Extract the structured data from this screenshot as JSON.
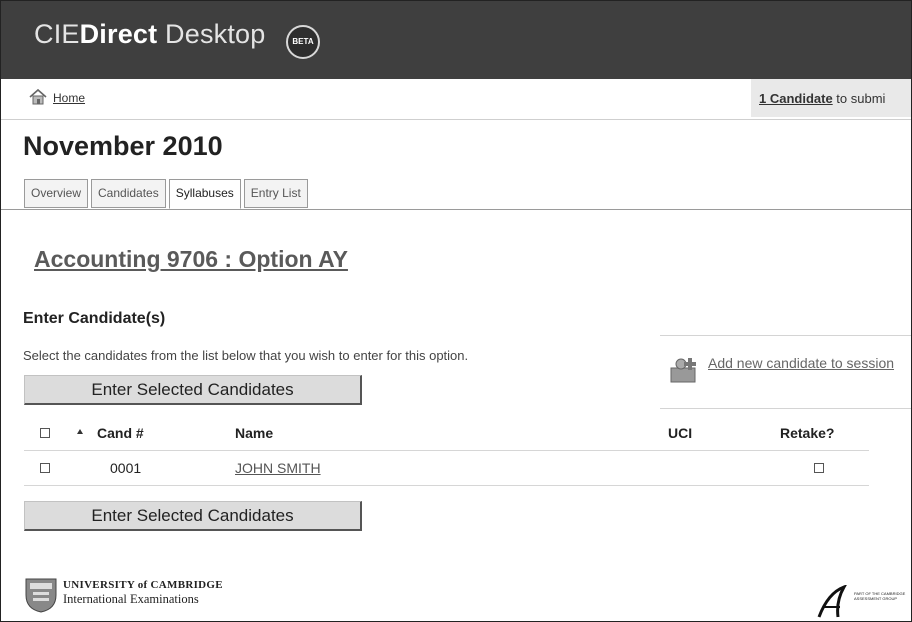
{
  "header": {
    "app_title_prefix": "CIE",
    "app_title_bold": "Direct",
    "app_title_suffix": " Desktop",
    "beta_label": "BETA"
  },
  "breadcrumb": {
    "home_label": "Home",
    "submit_count": "1 Candidate",
    "submit_text": " to submi"
  },
  "page_title": "November 2010",
  "tabs": [
    {
      "label": "Overview",
      "active": false
    },
    {
      "label": "Candidates",
      "active": false
    },
    {
      "label": "Syllabuses",
      "active": true
    },
    {
      "label": "Entry List",
      "active": false
    }
  ],
  "subject_title": "Accounting 9706 : Option AY",
  "section_heading": "Enter Candidate(s)",
  "instructions": "Select the candidates from the list below that you wish to enter for this option.",
  "enter_button_label": "Enter Selected Candidates",
  "add_candidate_link": "Add new candidate to session",
  "table": {
    "headers": {
      "cand": "Cand #",
      "name": "Name",
      "uci": "UCI",
      "retake": "Retake?"
    },
    "rows": [
      {
        "cand": "0001",
        "name": "JOHN SMITH",
        "uci": "",
        "retake": false
      }
    ]
  },
  "footer": {
    "cambridge_line1": "UNIVERSITY of CAMBRIDGE",
    "cambridge_line2": "International Examinations",
    "ca_text": "PART OF THE CAMBRIDGE ASSESSMENT GROUP"
  },
  "icons": [
    "home-icon",
    "add-candidate-icon",
    "sort-ascending-icon",
    "cambridge-crest-icon",
    "cambridge-assessment-logo"
  ],
  "colors": {
    "header_bg": "#3f3f3f",
    "button_bg": "#dcdcdc",
    "submit_bg": "#e9e9e9"
  }
}
